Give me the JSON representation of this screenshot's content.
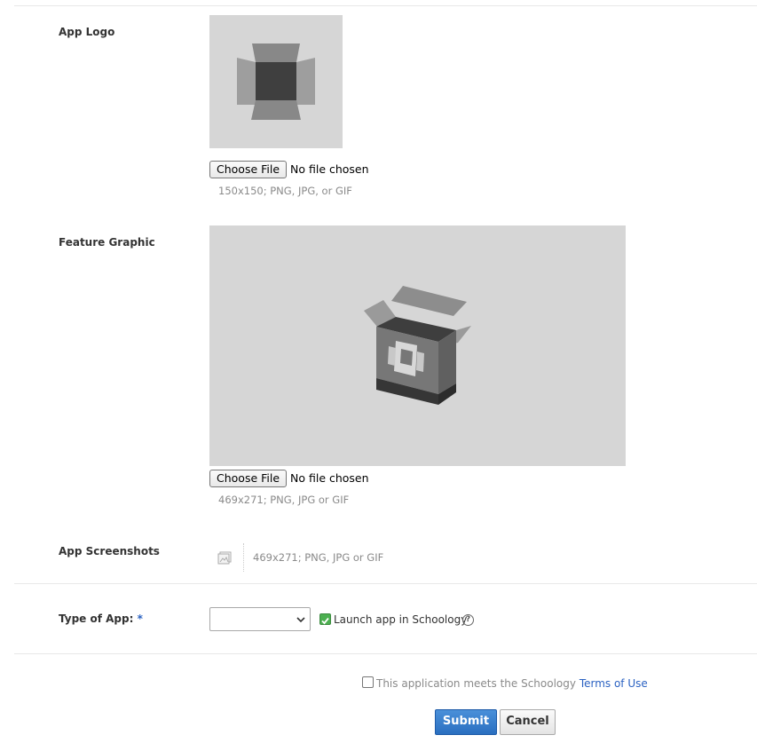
{
  "app_logo": {
    "label": "App Logo",
    "choose_file_label": "Choose File",
    "file_status": "No file chosen",
    "hint": "150x150; PNG, JPG, or GIF",
    "placeholder_icon": "open-box-top-icon"
  },
  "feature_graphic": {
    "label": "Feature Graphic",
    "choose_file_label": "Choose File",
    "file_status": "No file chosen",
    "hint": "469x271; PNG, JPG or GIF",
    "placeholder_icon": "open-box-icon"
  },
  "app_screenshots": {
    "label": "App Screenshots",
    "hint": "469x271; PNG, JPG or GIF",
    "upload_icon": "image-upload-icon"
  },
  "type_of_app": {
    "label": "Type of App:",
    "required_marker": "*",
    "selected_value": "",
    "launch_checkbox_checked": true,
    "launch_label": "Launch app in Schoology",
    "help_glyph": "?"
  },
  "terms": {
    "checked": false,
    "text": "This application meets the Schoology",
    "link_text": "Terms of Use"
  },
  "actions": {
    "submit_label": "Submit",
    "cancel_label": "Cancel"
  },
  "colors": {
    "accent": "#2b62c2",
    "submit_bg": "#3a7fd0",
    "checkbox_checked": "#4caf50",
    "placeholder_bg": "#d6d6d6"
  }
}
